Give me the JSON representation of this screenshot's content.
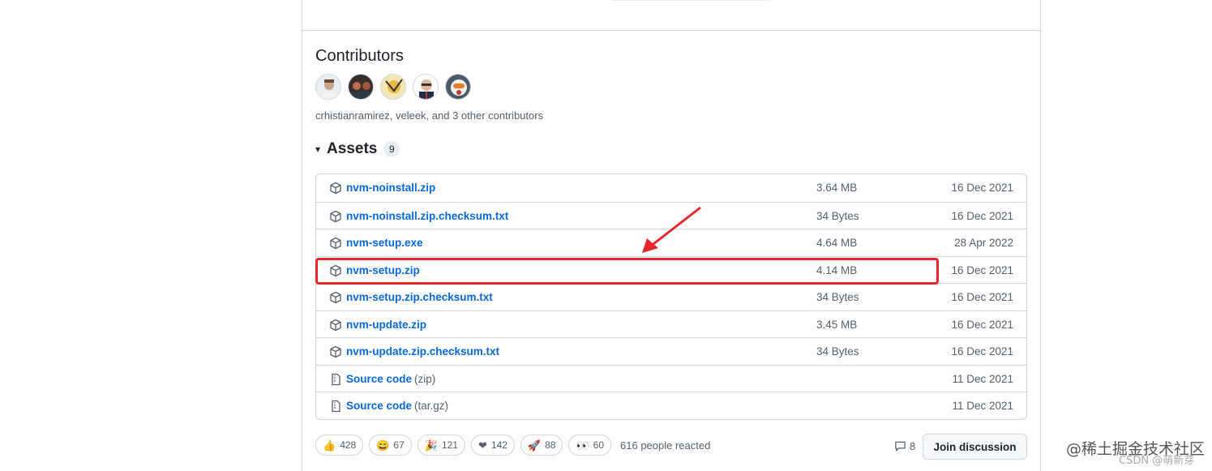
{
  "contributors": {
    "title": "Contributors",
    "avatars": [
      "crhistianramirez",
      "veleek",
      "contributor-3",
      "contributor-4",
      "contributor-5"
    ],
    "summary": "crhistianramirez, veleek, and 3 other contributors"
  },
  "assets": {
    "caret": "▾",
    "title": "Assets",
    "count": "9",
    "items": [
      {
        "name": "nvm-noinstall.zip",
        "suffix": "",
        "size": "3.64 MB",
        "date": "16 Dec 2021",
        "icon": "package-icon"
      },
      {
        "name": "nvm-noinstall.zip.checksum.txt",
        "suffix": "",
        "size": "34 Bytes",
        "date": "16 Dec 2021",
        "icon": "package-icon"
      },
      {
        "name": "nvm-setup.exe",
        "suffix": "",
        "size": "4.64 MB",
        "date": "28 Apr 2022",
        "icon": "package-icon"
      },
      {
        "name": "nvm-setup.zip",
        "suffix": "",
        "size": "4.14 MB",
        "date": "16 Dec 2021",
        "icon": "package-icon"
      },
      {
        "name": "nvm-setup.zip.checksum.txt",
        "suffix": "",
        "size": "34 Bytes",
        "date": "16 Dec 2021",
        "icon": "package-icon"
      },
      {
        "name": "nvm-update.zip",
        "suffix": "",
        "size": "3.45 MB",
        "date": "16 Dec 2021",
        "icon": "package-icon"
      },
      {
        "name": "nvm-update.zip.checksum.txt",
        "suffix": "",
        "size": "34 Bytes",
        "date": "16 Dec 2021",
        "icon": "package-icon"
      },
      {
        "name": "Source code",
        "suffix": "(zip)",
        "size": "",
        "date": "11 Dec 2021",
        "icon": "file-zip-icon"
      },
      {
        "name": "Source code",
        "suffix": "(tar.gz)",
        "size": "",
        "date": "11 Dec 2021",
        "icon": "file-zip-icon"
      }
    ]
  },
  "reactions": {
    "items": [
      {
        "emoji": "👍",
        "icon": "thumbs-up-icon",
        "count": "428"
      },
      {
        "emoji": "😄",
        "icon": "laugh-icon",
        "count": "67"
      },
      {
        "emoji": "🎉",
        "icon": "hooray-icon",
        "count": "121"
      },
      {
        "emoji": "❤",
        "icon": "heart-icon",
        "count": "142"
      },
      {
        "emoji": "🚀",
        "icon": "rocket-icon",
        "count": "88"
      },
      {
        "emoji": "👀",
        "icon": "eyes-icon",
        "count": "60"
      }
    ],
    "summary": "616 people reacted"
  },
  "discussion": {
    "comment_count": "8",
    "join_label": "Join discussion"
  },
  "annotation": {
    "highlighted_asset": "nvm-setup.zip",
    "color": "#e8262b"
  },
  "watermark": {
    "main": "@稀土掘金技术社区",
    "sub": "CSDN @萌新芽"
  },
  "colors": {
    "link": "#0969da",
    "muted": "#57606a",
    "border": "#d0d7de"
  }
}
